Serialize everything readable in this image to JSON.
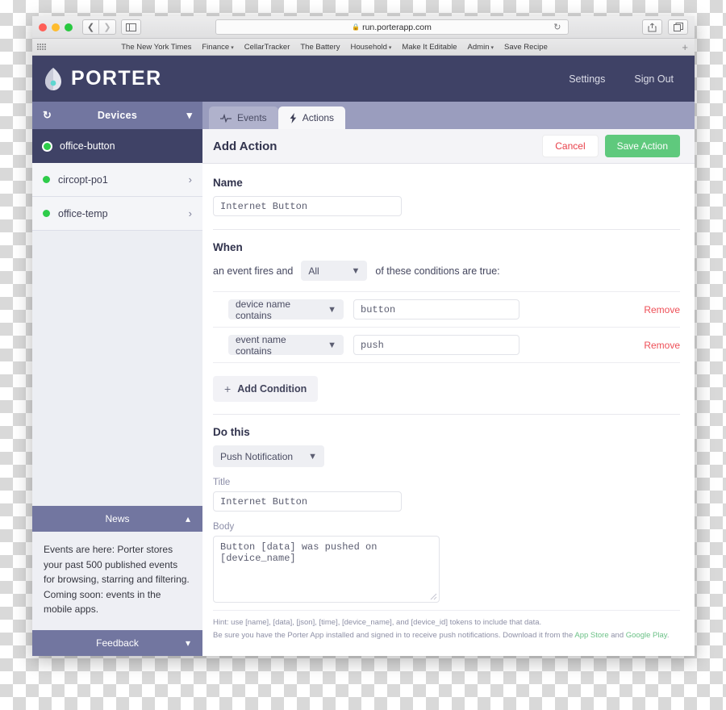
{
  "browser": {
    "url": "run.porterapp.com",
    "lock_icon": "lock-icon",
    "reload_icon": "reload-icon",
    "back_icon": "back-icon",
    "forward_icon": "forward-icon",
    "sidebar_icon": "sidebar-icon",
    "reader_icon": "reader-icon",
    "share_icon": "share-icon",
    "tabs_icon": "tabs-icon",
    "new_tab_label": "+",
    "bookmarks": [
      {
        "label": "The New York Times",
        "has_caret": false
      },
      {
        "label": "Finance",
        "has_caret": true
      },
      {
        "label": "CellarTracker",
        "has_caret": false
      },
      {
        "label": "The Battery",
        "has_caret": false
      },
      {
        "label": "Household",
        "has_caret": true
      },
      {
        "label": "Make It Editable",
        "has_caret": false
      },
      {
        "label": "Admin",
        "has_caret": true
      },
      {
        "label": "Save Recipe",
        "has_caret": false
      }
    ]
  },
  "app": {
    "brand": "PORTER",
    "logo_icon": "droplet-logo-icon",
    "header_links": [
      {
        "label": "Settings"
      },
      {
        "label": "Sign Out"
      }
    ]
  },
  "sidebar": {
    "header": {
      "refresh_icon": "refresh-icon",
      "title": "Devices",
      "chevron_icon": "chevron-down-icon"
    },
    "devices": [
      {
        "name": "office-button",
        "selected": true,
        "status": "online"
      },
      {
        "name": "circopt-po1",
        "selected": false,
        "status": "online"
      },
      {
        "name": "office-temp",
        "selected": false,
        "status": "online"
      }
    ],
    "news": {
      "title": "News",
      "chevron_icon": "chevron-up-icon",
      "text": "Events are here: Porter stores your past 500 published events for browsing, starring and filtering. Coming soon: events in the mobile apps."
    },
    "feedback": {
      "title": "Feedback",
      "chevron_icon": "chevron-down-icon"
    }
  },
  "main": {
    "tabs": [
      {
        "label": "Events",
        "icon": "pulse-icon",
        "active": false
      },
      {
        "label": "Actions",
        "icon": "lightning-bolt-icon",
        "active": true
      }
    ],
    "action_header": {
      "title": "Add Action",
      "cancel_label": "Cancel",
      "save_label": "Save Action"
    },
    "name_section": {
      "label": "Name",
      "value": "Internet Button"
    },
    "when_section": {
      "label": "When",
      "prefix_text": "an event fires and",
      "match_value": "All",
      "suffix_text": "of these conditions are true:",
      "conditions": [
        {
          "type": "device name contains",
          "value": "button",
          "remove_label": "Remove"
        },
        {
          "type": "event name contains",
          "value": "push",
          "remove_label": "Remove"
        }
      ],
      "add_condition_label": "Add Condition",
      "add_condition_icon": "plus-icon"
    },
    "do_section": {
      "label": "Do this",
      "action_type": "Push Notification",
      "title_label": "Title",
      "title_value": "Internet Button",
      "body_label": "Body",
      "body_value": "Button [data] was pushed on [device_name]",
      "hint_line_1": "Hint: use [name], [data], [json], [time], [device_name], and [device_id] tokens to include that data.",
      "hint_line_2_pre": "Be sure you have the Porter App installed and signed in to receive push notifications. Download it from the ",
      "hint_link_1": "App Store",
      "hint_line_2_mid": " and ",
      "hint_link_2": "Google Play",
      "hint_line_2_post": "."
    }
  },
  "colors": {
    "brand_dark": "#3f4266",
    "brand_mid": "#7276a0",
    "tab_bar": "#9a9dbe",
    "save_green": "#5fc97d",
    "danger_red": "#e8404a",
    "status_green": "#2ecc4a",
    "link_green": "#6cc187"
  }
}
